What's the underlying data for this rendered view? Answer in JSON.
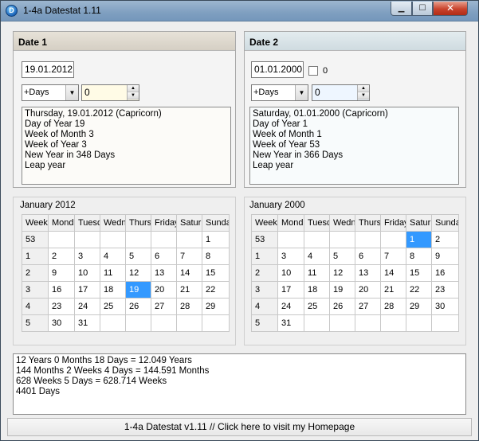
{
  "window": {
    "title": "1-4a Datestat 1.11",
    "icon_glyph": "D",
    "min_glyph": "▁",
    "max_glyph": "☐",
    "close_glyph": "✕"
  },
  "date1": {
    "header": "Date 1",
    "date_value": "19.01.2012",
    "offset_mode": "+Days",
    "offset_value": "0",
    "info": [
      "Thursday, 19.01.2012 (Capricorn)",
      "Day of Year 19",
      "Week of Month 3",
      "Week of Year 3",
      "New Year in 348 Days",
      "Leap year"
    ]
  },
  "date2": {
    "header": "Date 2",
    "date_value": "01.01.2000",
    "checkbox_label": "0",
    "offset_mode": "+Days",
    "offset_value": "0",
    "info": [
      "Saturday, 01.01.2000 (Capricorn)",
      "Day of Year 1",
      "Week of Month 1",
      "Week of Year 53",
      "New Year in 366 Days",
      "Leap year"
    ]
  },
  "calendar1": {
    "title": "January 2012",
    "headers": [
      "Week",
      "Monda",
      "Tuesd",
      "Wedn",
      "Thurs",
      "Friday",
      "Satur",
      "Sunda"
    ],
    "rows": [
      [
        "53",
        "",
        "",
        "",
        "",
        "",
        "",
        "1"
      ],
      [
        "1",
        "2",
        "3",
        "4",
        "5",
        "6",
        "7",
        "8"
      ],
      [
        "2",
        "9",
        "10",
        "11",
        "12",
        "13",
        "14",
        "15"
      ],
      [
        "3",
        "16",
        "17",
        "18",
        "19",
        "20",
        "21",
        "22"
      ],
      [
        "4",
        "23",
        "24",
        "25",
        "26",
        "27",
        "28",
        "29"
      ],
      [
        "5",
        "30",
        "31",
        "",
        "",
        "",
        "",
        ""
      ]
    ],
    "selected": "19"
  },
  "calendar2": {
    "title": "January 2000",
    "headers": [
      "Week",
      "Monda",
      "Tuesd",
      "Wedn",
      "Thurs",
      "Friday",
      "Satur",
      "Sunda"
    ],
    "rows": [
      [
        "53",
        "",
        "",
        "",
        "",
        "",
        "1",
        "2"
      ],
      [
        "1",
        "3",
        "4",
        "5",
        "6",
        "7",
        "8",
        "9"
      ],
      [
        "2",
        "10",
        "11",
        "12",
        "13",
        "14",
        "15",
        "16"
      ],
      [
        "3",
        "17",
        "18",
        "19",
        "20",
        "21",
        "22",
        "23"
      ],
      [
        "4",
        "24",
        "25",
        "26",
        "27",
        "28",
        "29",
        "30"
      ],
      [
        "5",
        "31",
        "",
        "",
        "",
        "",
        "",
        ""
      ]
    ],
    "selected": "1"
  },
  "result": [
    "12 Years 0 Months 18 Days = 12.049 Years",
    "144 Months 2 Weeks 4 Days = 144.591 Months",
    "628 Weeks 5 Days = 628.714 Weeks",
    "4401 Days"
  ],
  "footer": "1-4a Datestat v1.11 // Click here to visit my Homepage"
}
